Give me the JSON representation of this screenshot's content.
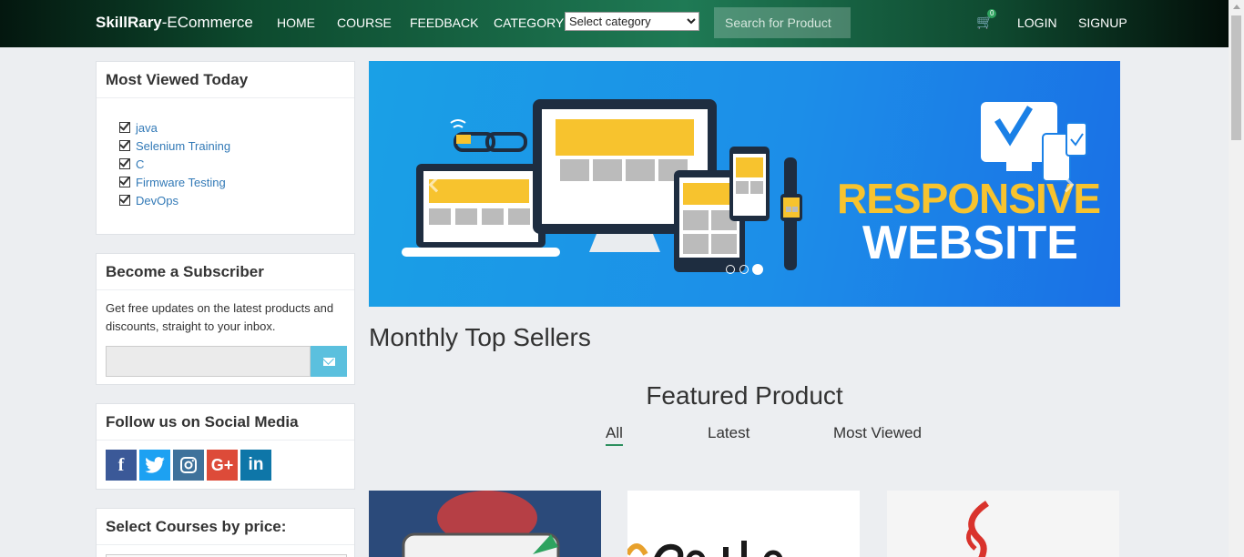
{
  "navbar": {
    "brand_bold": "SkillRary",
    "brand_rest": "-ECommerce",
    "links": [
      "HOME",
      "COURSE",
      "FEEDBACK",
      "CATEGORY"
    ],
    "category_select": "Select category",
    "search_placeholder": "Search for Product",
    "cart_count": "0",
    "login": "LOGIN",
    "signup": "SIGNUP",
    "theme_color": "#1f7a55"
  },
  "sidebar": {
    "most_viewed": {
      "title": "Most Viewed Today",
      "items": [
        "java",
        "Selenium Training",
        "C",
        "Firmware Testing",
        "DevOps"
      ]
    },
    "subscriber": {
      "title": "Become a Subscriber",
      "text": "Get free updates on the latest products and discounts, straight to your inbox."
    },
    "social": {
      "title": "Follow us on Social Media",
      "icons": [
        "facebook-icon",
        "twitter-icon",
        "instagram-icon",
        "google-plus-icon",
        "linkedin-icon"
      ],
      "colors": [
        "#3b5998",
        "#1da1f2",
        "#3f729b",
        "#dd4b39",
        "#0e76a8"
      ]
    },
    "price": {
      "title": "Select Courses by price:"
    }
  },
  "banner": {
    "line1": "RESPONSIVE",
    "line2": "WEBSITE",
    "active_slide": 3,
    "slide_count": 3
  },
  "main": {
    "monthly_title": "Monthly Top Sellers",
    "featured_title": "Featured Product",
    "tabs": [
      "All",
      "Latest",
      "Most Viewed"
    ],
    "active_tab": "All"
  }
}
